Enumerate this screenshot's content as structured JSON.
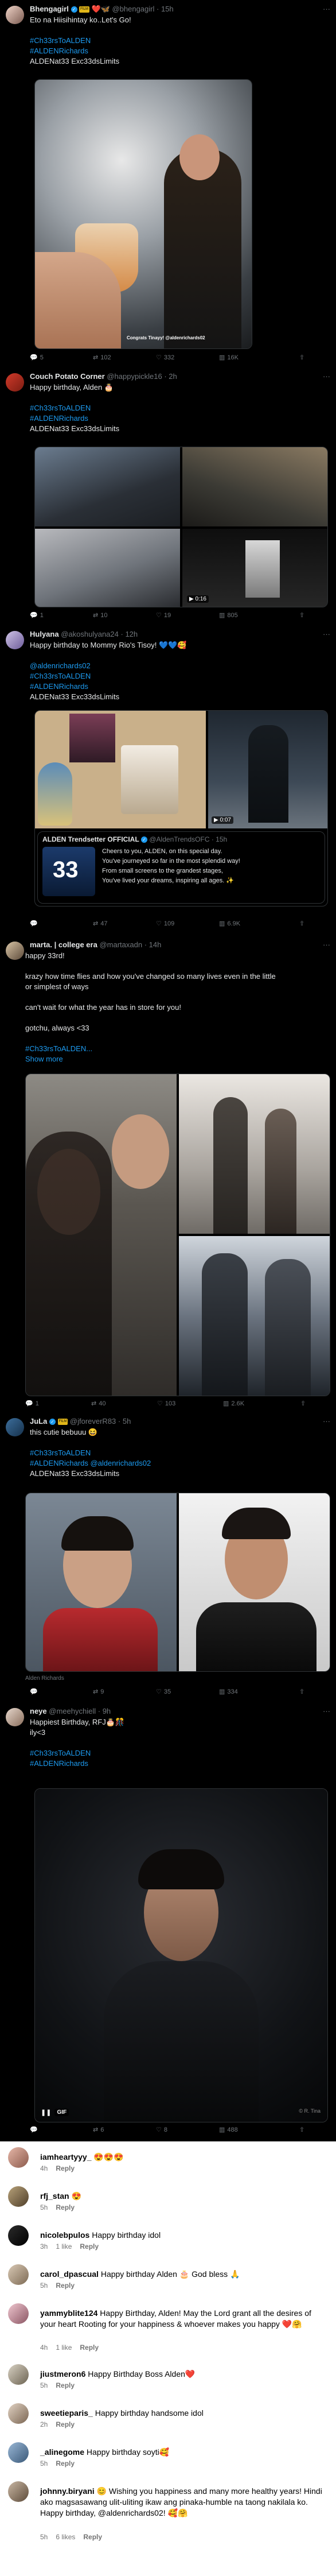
{
  "tweets": [
    {
      "name": "Bhengagirl",
      "name_badge": "FILM",
      "name_emojis": "❤️🦋",
      "handle": "@bhengagirl",
      "time": "15h",
      "lines": [
        "Eto na Hiisihintay ko..Let's Go!",
        "",
        "#Ch33rsToALDEN",
        "#ALDENRichards",
        "ALDENat33 Exc33dsLimits"
      ],
      "media_caption": "Congrats Tinayy! @aldenrichards02",
      "actions": {
        "replies": "5",
        "retweets": "102",
        "likes": "332",
        "views": "16K"
      }
    },
    {
      "name": "Couch Potato Corner",
      "handle": "@happypickle16",
      "time": "2h",
      "lines": [
        "Happy birthday, Alden 🎂",
        "",
        "#Ch33rsToALDEN",
        "#ALDENRichards",
        "ALDENat33 Exc33dsLimits"
      ],
      "video_duration": "0:16",
      "actions": {
        "replies": "1",
        "retweets": "10",
        "likes": "19",
        "views": "805"
      }
    },
    {
      "name": "Hulyana",
      "handle": "@akoshulyana24",
      "time": "12h",
      "lines": [
        "Happy birthday to Mommy Rio's Tisoy! 💙💙🥰",
        "",
        "@aldenrichards02",
        "#Ch33rsToALDEN",
        "#ALDENRichards",
        "ALDENat33 Exc33dsLimits"
      ],
      "video_duration": "0:07",
      "quote": {
        "name": "ALDEN Trendsetter OFFICIAL",
        "handle": "@AldenTrendsOFC",
        "time": "15h",
        "thumb_number": "33",
        "lines": [
          "Cheers to you, ALDEN, on this special day.",
          "You've journeyed so far in the most splendid way!",
          "From small screens to the grandest stages,",
          "You've lived your dreams, inspiring all ages. ✨"
        ]
      },
      "actions": {
        "replies": "",
        "retweets": "47",
        "likes": "109",
        "views": "6.9K"
      }
    },
    {
      "name": "marta. | college era",
      "handle": "@martaxadn",
      "time": "14h",
      "lines": [
        "happy 33rd!",
        "",
        "krazy how time flies and how you've changed so many lives even in the little",
        "or simplest of ways",
        "",
        "can't wait for what the year has in store for you!",
        "",
        "gotchu, always <33",
        "",
        "#Ch33rsToALDEN...",
        "Show more"
      ],
      "actions": {
        "replies": "1",
        "retweets": "40",
        "likes": "103",
        "views": "2.6K"
      }
    },
    {
      "name": "JuLa",
      "name_badge": "FILM",
      "handle": "@jforeverR83",
      "time": "5h",
      "lines": [
        "this cutie bebuuu 😆",
        "",
        "#Ch33rsToALDEN",
        "#ALDENRichards @aldenrichards02",
        "ALDENat33 Exc33dsLimits"
      ],
      "media_caption": "Alden Richards",
      "actions": {
        "replies": "",
        "retweets": "9",
        "likes": "35",
        "views": "334"
      }
    },
    {
      "name": "neye",
      "handle": "@meehychiell",
      "time": "9h",
      "lines": [
        "Happiest Birthday, RFJ🎂🎊",
        "ily<3",
        "",
        "#Ch33rsToALDEN",
        "#ALDENRichards"
      ],
      "gif_label": "GIF",
      "watermark": "© R. Tina",
      "actions": {
        "replies": "",
        "retweets": "6",
        "likes": "8",
        "views": "488"
      }
    }
  ],
  "comments": [
    {
      "user": "iamheartyyy_",
      "text": "😍😍😍",
      "time": "4h",
      "likes": "",
      "reply": "Reply"
    },
    {
      "user": "rfj_stan",
      "text": "😍",
      "time": "5h",
      "likes": "",
      "reply": "Reply"
    },
    {
      "user": "nicolebpulos",
      "text": "Happy birthday idol",
      "time": "3h",
      "likes": "1 like",
      "reply": "Reply"
    },
    {
      "user": "carol_dpascual",
      "text": "Happy birthday Alden 🎂 God bless 🙏",
      "time": "5h",
      "likes": "",
      "reply": "Reply"
    },
    {
      "user": "yammyblite124",
      "text": "Happy Birthday, Alden! May the Lord grant all the desires of your heart Rooting for your happiness & whoever makes you happy ❤️🤗",
      "time": "4h",
      "likes": "1 like",
      "reply": "Reply"
    },
    {
      "user": "jiustmeron6",
      "text": "Happy Birthday Boss Alden❤️",
      "time": "5h",
      "likes": "",
      "reply": "Reply"
    },
    {
      "user": "sweetieparis_",
      "text": "Happy birthday handsome idol",
      "time": "2h",
      "likes": "",
      "reply": "Reply"
    },
    {
      "user": "_alinegome",
      "text": "Happy birthday soyti🥰",
      "time": "5h",
      "likes": "",
      "reply": "Reply"
    },
    {
      "user": "johnny.biryani",
      "text": "😊 Wishing you happiness and many more healthy years! Hindi ako magsasawang ulit-uliting ikaw ang pinaka-humble na taong nakilala ko. Happy birthday, @aldenrichards02! 🥰🤗",
      "time": "5h",
      "likes": "6 likes",
      "reply": "Reply"
    }
  ],
  "colors": {
    "background": "#000000",
    "accent": "#1d9bf0",
    "muted": "#71767b",
    "divider": "#2f3336",
    "comments_bg": "#ffffff"
  },
  "icons": [
    "reply-icon",
    "retweet-icon",
    "like-icon",
    "views-icon",
    "bookmark-icon",
    "share-icon",
    "verified-icon",
    "more-icon"
  ]
}
